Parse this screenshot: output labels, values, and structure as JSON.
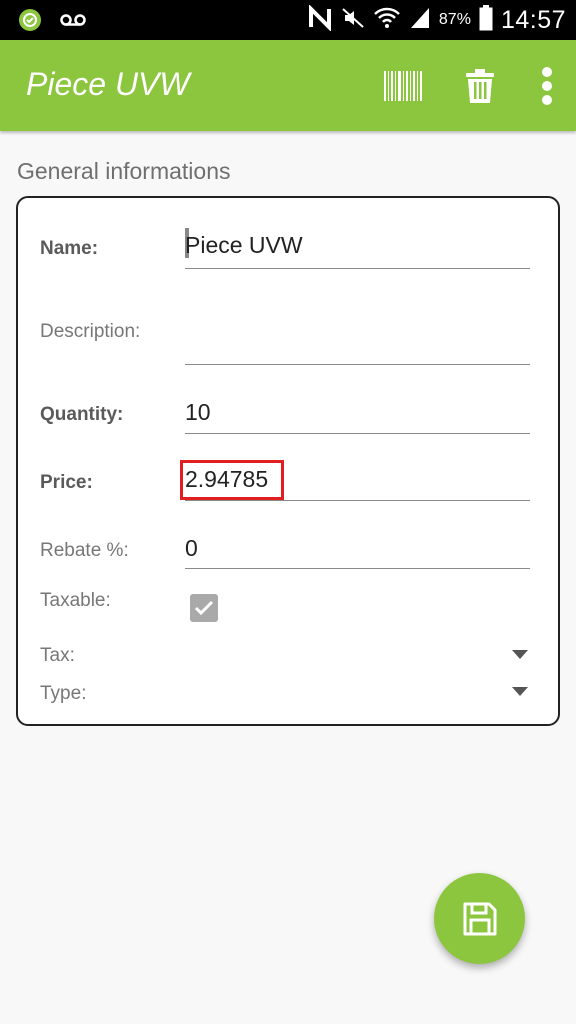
{
  "status_bar": {
    "battery_percent": "87%",
    "time": "14:57",
    "icons": [
      "circle-check-icon",
      "voicemail-icon",
      "nfc-icon",
      "mute-icon",
      "wifi-icon",
      "signal-icon",
      "battery-icon"
    ]
  },
  "toolbar": {
    "title": "Piece UVW",
    "actions": [
      "barcode-icon",
      "trash-icon",
      "more-vert-icon"
    ],
    "color": "#8cc63f"
  },
  "section": {
    "title": "General informations"
  },
  "form": {
    "name_label": "Name:",
    "name_value": "Piece UVW",
    "description_label": "Description:",
    "description_value": "",
    "quantity_label": "Quantity:",
    "quantity_value": "10",
    "price_label": "Price:",
    "price_value": "2.94785",
    "rebate_label": "Rebate %:",
    "rebate_value": "0",
    "taxable_label": "Taxable:",
    "taxable_checked": true,
    "tax_label": "Tax:",
    "type_label": "Type:"
  },
  "fab": {
    "icon": "save-icon"
  }
}
